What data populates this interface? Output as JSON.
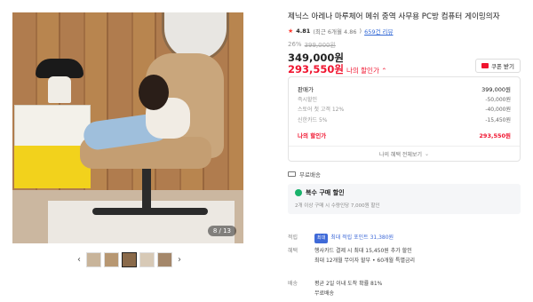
{
  "gallery": {
    "counter": "8 / 13",
    "prev_icon": "chevron-left-icon",
    "next_icon": "chevron-right-icon",
    "prev_glyph": "‹",
    "next_glyph": "›"
  },
  "product": {
    "title": "제닉스 아레나 마루체어 메쉬 중역 사무용 PC방 컴퓨터 게이밍의자",
    "star": "★",
    "rating": "4.81",
    "rating_detail": "(최근 6개월 4.86",
    "rating_detail_end": ")",
    "reviews": "659건 리뷰",
    "discount_pct": "26%",
    "original_price": "399,000원",
    "price": "349,000원",
    "sale_price": "293,550원",
    "sale_label": "나의 할인가 ⌃",
    "coupon_label": "쿠폰 받기"
  },
  "breakdown": {
    "rows": [
      {
        "label": "판매가",
        "amount": "399,000원"
      },
      {
        "label": "즉시할인",
        "amount": "-50,000원"
      },
      {
        "label": "스토어 첫 고객 12%",
        "amount": "-40,000원"
      },
      {
        "label": "신한카드 5%",
        "amount": "-15,450원"
      }
    ],
    "total_label": "나의 할인가",
    "total_amount": "293,550원",
    "more_label": "나의 혜택 전체보기",
    "more_glyph": "⌄"
  },
  "shipping": {
    "label": "무료배송"
  },
  "multi_buy": {
    "title": "복수 구매 할인",
    "desc": "2개 이상 구매 시 수량인당 7,000원 할인"
  },
  "meta": {
    "points_key": "적립",
    "points_badge": "최대",
    "points_text": "최대 적립 포인트 31,380원",
    "benefit_key": "혜택",
    "benefit_line1": "행사카드 결제 시 최대 15,450원 추가 할인",
    "benefit_line2": "최대 12개월 무이자 할부 • 60개월 특별금리",
    "delivery_key": "배송",
    "delivery_line1": "평균 2일 이내 도착 확률 81%",
    "delivery_line2": "무료배송"
  },
  "colors": {
    "sale": "#f0142f",
    "link": "#3369d6",
    "accent_green": "#19b26b"
  }
}
